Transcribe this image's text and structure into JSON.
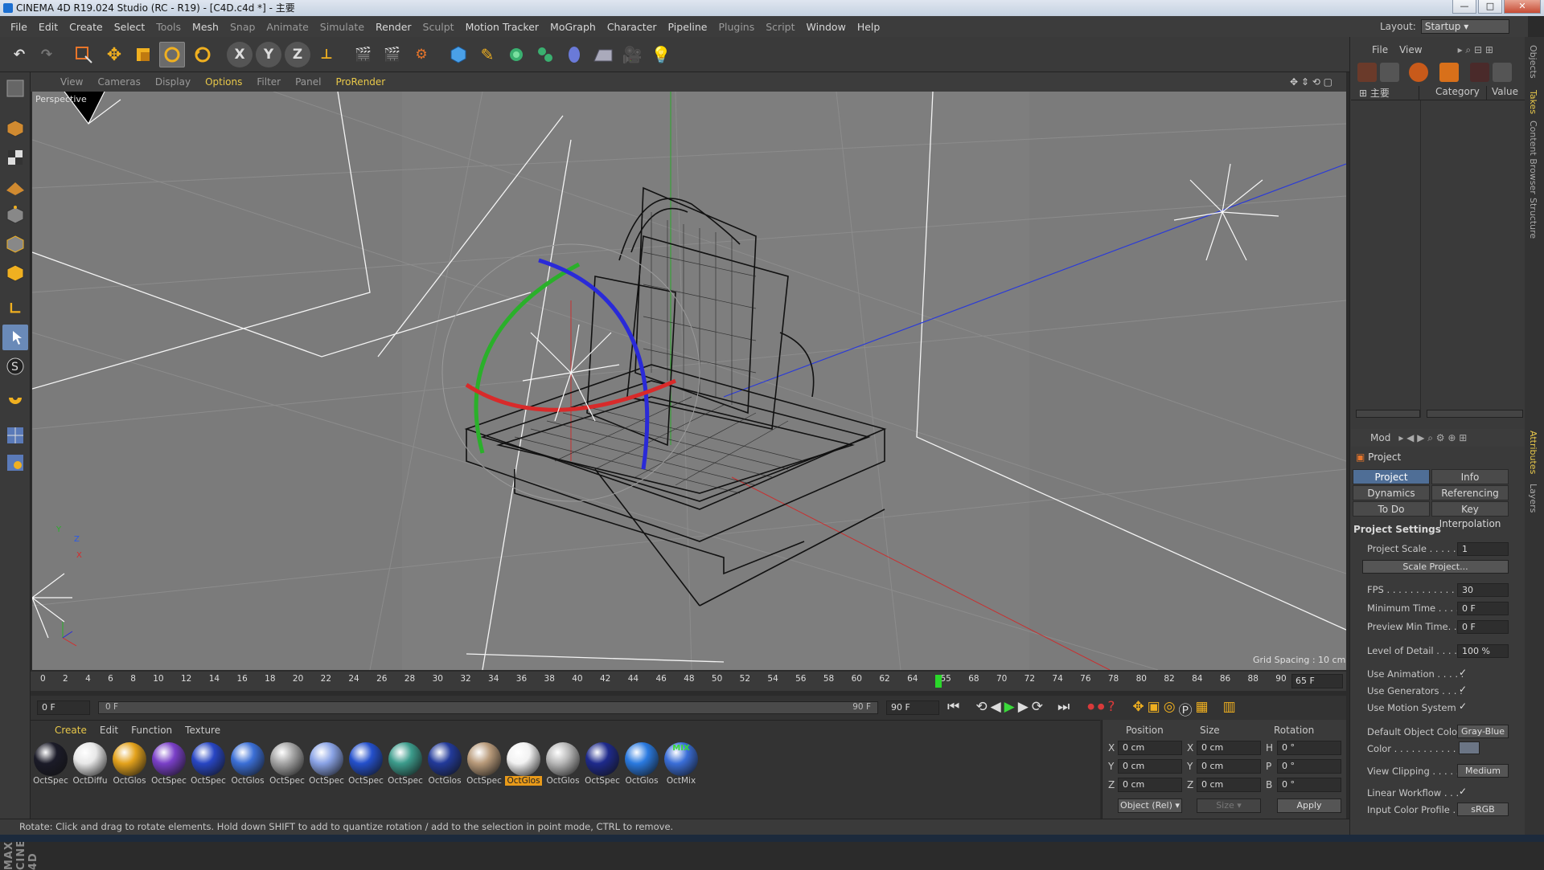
{
  "window": {
    "title": "CINEMA 4D R19.024 Studio (RC - R19) - [C4D.c4d *] - 主要",
    "controls": {
      "minimize": "—",
      "maximize": "□",
      "close": "✕"
    }
  },
  "menubar": [
    "File",
    "Edit",
    "Create",
    "Select",
    "Tools",
    "Mesh",
    "Snap",
    "Animate",
    "Simulate",
    "Render",
    "Sculpt",
    "Motion Tracker",
    "MoGraph",
    "Character",
    "Pipeline",
    "Plugins",
    "Script",
    "Window",
    "Help"
  ],
  "layout": {
    "label": "Layout:",
    "value": "Startup"
  },
  "viewport": {
    "menu": [
      "View",
      "Cameras",
      "Display",
      "Options",
      "Filter",
      "Panel",
      "ProRender"
    ],
    "label": "Perspective",
    "grid_spacing": "Grid Spacing : 10 cm",
    "axis": {
      "y": "Y",
      "z": "Z",
      "x": "X"
    }
  },
  "timeline": {
    "ticks": [
      "0",
      "2",
      "4",
      "6",
      "8",
      "10",
      "12",
      "14",
      "16",
      "18",
      "20",
      "22",
      "24",
      "26",
      "28",
      "30",
      "32",
      "34",
      "36",
      "38",
      "40",
      "42",
      "44",
      "46",
      "48",
      "50",
      "52",
      "54",
      "56",
      "58",
      "60",
      "62",
      "64",
      "655",
      "68",
      "70",
      "72",
      "74",
      "76",
      "78",
      "80",
      "82",
      "84",
      "86",
      "88",
      "90"
    ],
    "current_frame": "65 F",
    "start": "0 F",
    "range_start": "0 F",
    "range_end": "90 F",
    "end": "90 F"
  },
  "materials": {
    "menu": [
      "Create",
      "Edit",
      "Function",
      "Texture"
    ],
    "items": [
      {
        "label": "OctSpec",
        "color": "#1b1b28"
      },
      {
        "label": "OctDiffu",
        "color": "#e8e8e8"
      },
      {
        "label": "OctGlos",
        "color": "#e3a21c"
      },
      {
        "label": "OctSpec",
        "color": "#7a3fc8"
      },
      {
        "label": "OctSpec",
        "color": "#2846c4"
      },
      {
        "label": "OctGlos",
        "color": "#3b6fd6"
      },
      {
        "label": "OctSpec",
        "color": "#a5a5a5"
      },
      {
        "label": "OctSpec",
        "color": "#8aa3e6"
      },
      {
        "label": "OctSpec",
        "color": "#2450cc"
      },
      {
        "label": "OctSpec",
        "color": "#3c9c8c"
      },
      {
        "label": "OctGlos",
        "color": "#223a9a"
      },
      {
        "label": "OctSpec",
        "color": "#b89a7a"
      },
      {
        "label": "OctGlos",
        "color": "#f2f2f2"
      },
      {
        "label": "OctGlos",
        "color": "#b8b8b8"
      },
      {
        "label": "OctSpec",
        "color": "#1e2a8c"
      },
      {
        "label": "OctGlos",
        "color": "#2a7ae0"
      },
      {
        "label": "OctMix",
        "color": "#3a6ed8",
        "badge": "MIX"
      }
    ],
    "selected_index": 12
  },
  "coords": {
    "headers": {
      "position": "Position",
      "size": "Size",
      "rotation": "Rotation"
    },
    "rows": [
      {
        "axis": "X",
        "pos": "0 cm",
        "saxis": "X",
        "size": "0 cm",
        "raxis": "H",
        "rot": "0 °"
      },
      {
        "axis": "Y",
        "pos": "0 cm",
        "saxis": "Y",
        "size": "0 cm",
        "raxis": "P",
        "rot": "0 °"
      },
      {
        "axis": "Z",
        "pos": "0 cm",
        "saxis": "Z",
        "size": "0 cm",
        "raxis": "B",
        "rot": "0 °"
      }
    ],
    "mode": "Object (Rel)",
    "size_mode": "Size",
    "apply": "Apply"
  },
  "status": "Rotate: Click and drag to rotate elements. Hold down SHIFT to add to quantize rotation / add to the selection in point mode, CTRL to remove.",
  "objects": {
    "menu": [
      "File",
      "View"
    ],
    "columns": {
      "name": "主要",
      "category": "Category",
      "value": "Value"
    }
  },
  "attributes": {
    "mode": "Mod",
    "title": "Project",
    "tabs": [
      "Project Settings",
      "Info",
      "Dynamics",
      "Referencing",
      "To Do",
      "Key Interpolation"
    ],
    "section": "Project Settings",
    "fields": {
      "project_scale": {
        "label": "Project Scale . . . . . .",
        "value": "1"
      },
      "scale_project": "Scale Project...",
      "fps": {
        "label": "FPS . . . . . . . . . . . . . .",
        "value": "30"
      },
      "min_time": {
        "label": "Minimum Time . . . .",
        "value": "0 F"
      },
      "preview_min": {
        "label": "Preview Min Time. . .",
        "value": "0 F"
      },
      "lod": {
        "label": "Level of Detail . . . . .",
        "value": "100 %"
      },
      "use_anim": {
        "label": "Use Animation . . . . .",
        "value": "✓"
      },
      "use_gen": {
        "label": "Use Generators . . . .",
        "value": "✓"
      },
      "use_motion": {
        "label": "Use Motion System",
        "value": "✓"
      },
      "def_color": {
        "label": "Default Object Color",
        "value": "Gray-Blue"
      },
      "color": {
        "label": "Color . . . . . . . . . . ."
      },
      "view_clip": {
        "label": "View Clipping . . . . .",
        "value": "Medium"
      },
      "linear": {
        "label": "Linear Workflow . . .",
        "value": "✓"
      },
      "icp": {
        "label": "Input Color Profile . .",
        "value": "sRGB"
      }
    }
  },
  "vtabs": [
    "Objects",
    "Takes",
    "Content Browser",
    "Structure",
    "Attributes",
    "Layers"
  ],
  "brand": "MAXON CINEMA 4D"
}
